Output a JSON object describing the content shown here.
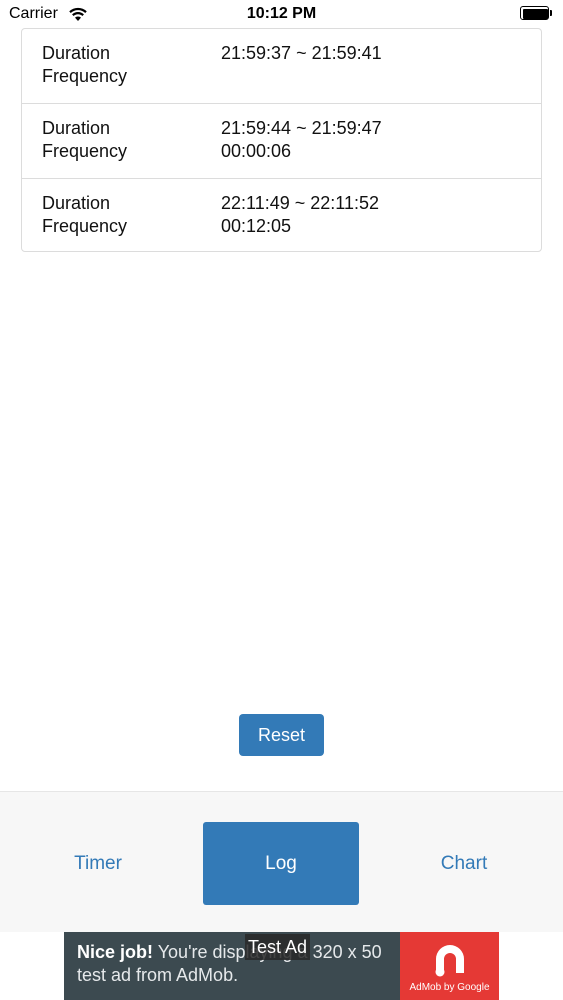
{
  "status_bar": {
    "carrier": "Carrier",
    "time": "10:12 PM",
    "icons": [
      "wifi-icon",
      "battery-icon"
    ]
  },
  "log": {
    "rows": [
      {
        "duration_label": "Duration",
        "frequency_label": "Frequency",
        "duration": "21:59:37 ~ 21:59:41",
        "frequency": ""
      },
      {
        "duration_label": "Duration",
        "frequency_label": "Frequency",
        "duration": "21:59:44 ~ 21:59:47",
        "frequency": "00:00:06"
      },
      {
        "duration_label": "Duration",
        "frequency_label": "Frequency",
        "duration": "22:11:49 ~ 22:11:52",
        "frequency": "00:12:05"
      }
    ]
  },
  "reset_label": "Reset",
  "tabs": [
    {
      "label": "Timer",
      "active": false
    },
    {
      "label": "Log",
      "active": true
    },
    {
      "label": "Chart",
      "active": false
    }
  ],
  "ad": {
    "headline": "Nice job!",
    "body": " You're displaying a 320 x 50 test ad from AdMob.",
    "label": "Test Ad",
    "caption": "AdMob by Google",
    "icon": "admob-icon"
  },
  "colors": {
    "accent": "#337ab7",
    "tab_bar_bg": "#f7f7f7",
    "ad_bg": "#3c4a50",
    "ad_logo_bg": "#e53935"
  }
}
